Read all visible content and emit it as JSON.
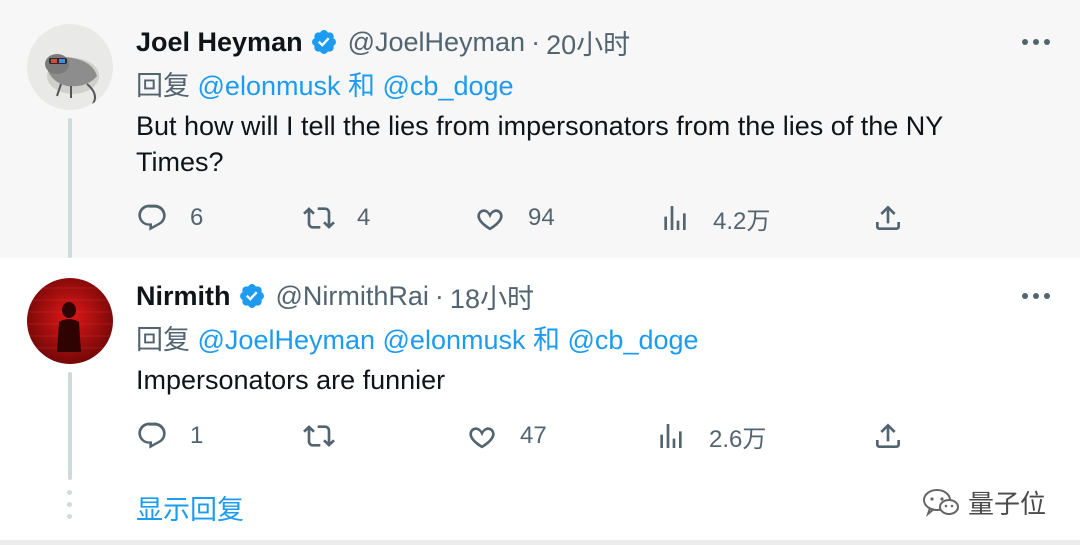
{
  "tweets": [
    {
      "name": "Joel Heyman",
      "handle": "@JoelHeyman",
      "separator": "·",
      "time": "20小时",
      "reply_prefix": "回复",
      "mentions": [
        "@elonmusk",
        "@cb_doge"
      ],
      "conjunction": "和",
      "text": "But how will I tell the lies from impersonators from the lies of the NY Times?",
      "stats": {
        "replies": "6",
        "retweets": "4",
        "likes": "94",
        "views": "4.2万"
      }
    },
    {
      "name": "Nirmith",
      "handle": "@NirmithRai",
      "separator": "·",
      "time": "18小时",
      "reply_prefix": "回复",
      "mentions": [
        "@JoelHeyman",
        "@elonmusk",
        "@cb_doge"
      ],
      "conjunction": "和",
      "text": "Impersonators are funnier",
      "stats": {
        "replies": "1",
        "retweets": "",
        "likes": "47",
        "views": "2.6万"
      }
    }
  ],
  "show_replies_label": "显示回复",
  "watermark": "量子位",
  "colors": {
    "accent": "#1d9bf0",
    "muted": "#536471",
    "verified": "#1d9bf0"
  },
  "icons": [
    "verified-badge-icon",
    "more-icon",
    "reply-icon",
    "retweet-icon",
    "like-icon",
    "views-icon",
    "share-icon",
    "wechat-icon"
  ]
}
